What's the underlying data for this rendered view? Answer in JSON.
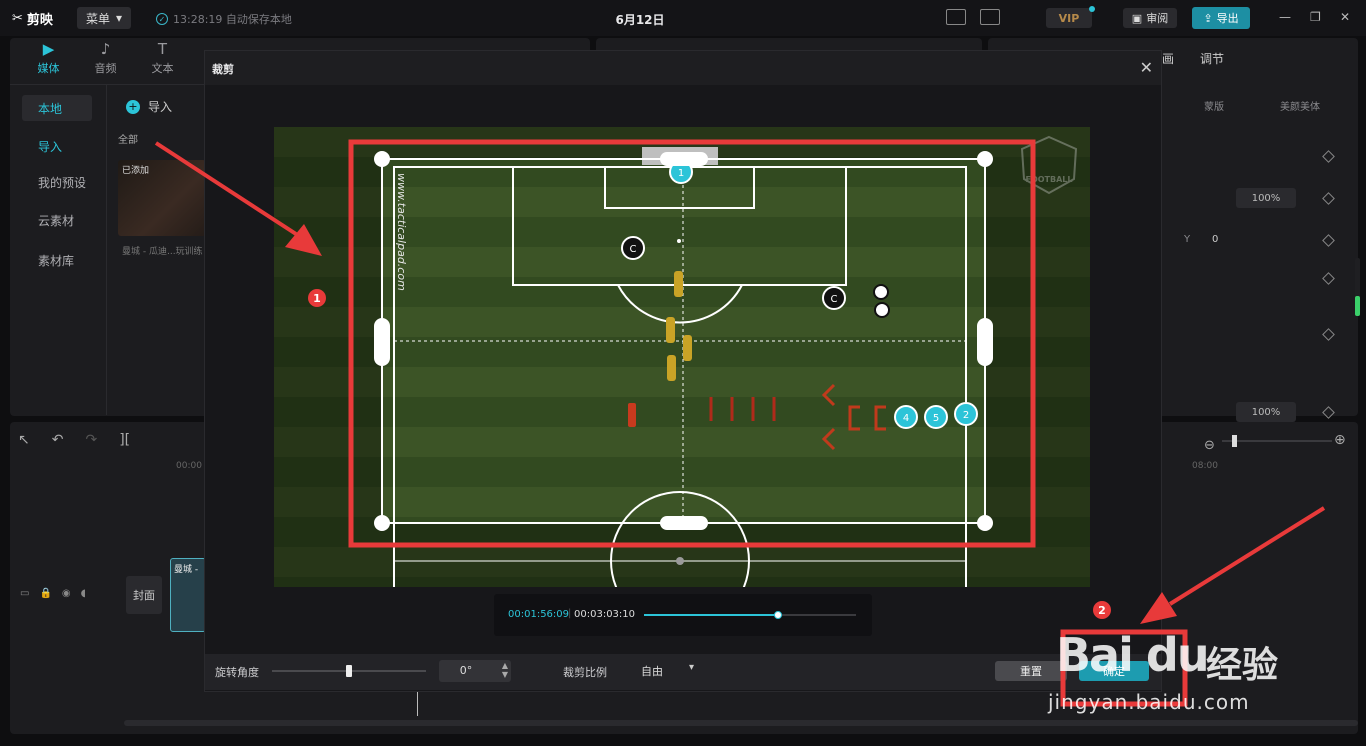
{
  "app": {
    "logo": "剪映",
    "menu_label": "菜单",
    "autosave": "13:28:19 自动保存本地",
    "project_title": "6月12日",
    "vip_label": "VIP",
    "review_label": "审阅",
    "export_label": "导出"
  },
  "media_tabs": [
    {
      "label": "媒体",
      "icon": "media-icon"
    },
    {
      "label": "音频",
      "icon": "audio-icon"
    },
    {
      "label": "文本",
      "icon": "text-icon"
    }
  ],
  "sidebar": {
    "items": [
      {
        "label": "本地"
      },
      {
        "label": "导入"
      },
      {
        "label": "我的预设"
      },
      {
        "label": "云素材"
      },
      {
        "label": "素材库"
      }
    ]
  },
  "library": {
    "import_label": "导入",
    "all_label": "全部",
    "added_tag": "已添加",
    "thumb_caption": "曼城 - 瓜迪...玩训练"
  },
  "right_panel": {
    "tab_adjust": "调节",
    "tab_partial": "画",
    "sub_tab_1": "蒙版",
    "sub_tab_2": "美颜美体",
    "scale_value": "100%",
    "y_label": "Y",
    "y_value": "0",
    "opacity_value": "100%"
  },
  "timeline": {
    "cover_label": "封面",
    "clip_label": "曼城 -",
    "ruler_0": "00:00",
    "ruler_8": "08:00"
  },
  "crop_dialog": {
    "title": "裁剪",
    "current_time": "00:01:56:09",
    "separator": "|",
    "total_time": "00:03:03:10",
    "playback_progress": 0.633,
    "rotation_label": "旋转角度",
    "rotation_value": "0°",
    "rotation_slider_fraction": 0.5,
    "ratio_label": "裁剪比例",
    "ratio_value": "自由",
    "reset_label": "重置",
    "confirm_label": "确定"
  },
  "pitch": {
    "watermark_text": "www.tacticalpad.com",
    "brand_text": "FOOTBALL",
    "player_numbers": [
      "1",
      "4",
      "5",
      "2"
    ],
    "coach_marks": [
      "C",
      "C"
    ]
  },
  "annotations": {
    "badge_1": "1",
    "badge_2": "2",
    "highlight_color": "#e83a3a"
  },
  "baidu_watermark": {
    "brand": "Bai du",
    "product": "经验",
    "url": "jingyan.baidu.com"
  },
  "colors": {
    "accent": "#2cc4d8",
    "confirm": "#1d9cb0",
    "background": "#0e0e10"
  }
}
